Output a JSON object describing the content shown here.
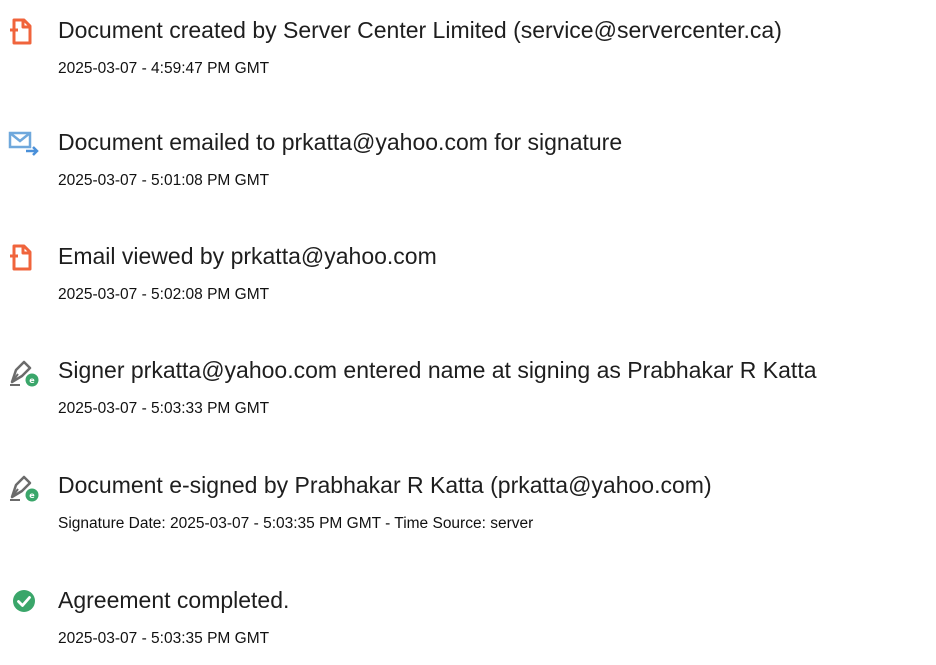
{
  "colors": {
    "doc_icon": "#f0643c",
    "email_icon": "#6fa8dc",
    "sign_icon_pen": "#6b6b6b",
    "sign_icon_badge": "#3aa66a",
    "complete_icon": "#3aa66a"
  },
  "events": [
    {
      "icon": "document-created-icon",
      "title": "Document created by Server Center Limited (service@servercenter.ca)",
      "timestamp": "2025-03-07 - 4:59:47 PM GMT"
    },
    {
      "icon": "email-sent-icon",
      "title": "Document emailed to prkatta@yahoo.com for signature",
      "timestamp": "2025-03-07 - 5:01:08 PM GMT"
    },
    {
      "icon": "document-viewed-icon",
      "title": "Email viewed by prkatta@yahoo.com",
      "timestamp": "2025-03-07 - 5:02:08 PM GMT"
    },
    {
      "icon": "signer-pen-icon",
      "title": "Signer prkatta@yahoo.com entered name at signing as Prabhakar R Katta",
      "timestamp": "2025-03-07 - 5:03:33 PM GMT"
    },
    {
      "icon": "e-sign-pen-icon",
      "title": "Document e-signed by Prabhakar R Katta (prkatta@yahoo.com)",
      "timestamp": "Signature Date: 2025-03-07 - 5:03:35 PM GMT - Time Source: server"
    },
    {
      "icon": "check-circle-icon",
      "title": "Agreement completed.",
      "timestamp": "2025-03-07 - 5:03:35 PM GMT"
    }
  ]
}
